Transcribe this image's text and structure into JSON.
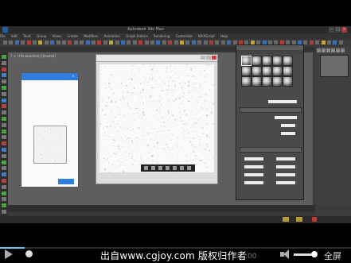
{
  "app": {
    "title": "Autodesk 3ds Max",
    "menus": [
      "File",
      "Edit",
      "Tools",
      "Group",
      "Views",
      "Create",
      "Modifiers",
      "Animation",
      "Graph Editors",
      "Rendering",
      "Customize",
      "MAXScript",
      "Help"
    ],
    "viewport_label": "[ + ] [Perspective] [Shaded]"
  },
  "left_panel": {
    "title": "",
    "close": "×",
    "rows": [
      "",
      "",
      "",
      "",
      ""
    ],
    "highlight_rows": [
      "",
      ""
    ],
    "ok_label": ""
  },
  "viewer": {
    "title": ""
  },
  "material_editor": {
    "title": "",
    "menus": "",
    "rows": [
      "",
      "",
      "",
      "",
      "",
      ""
    ]
  },
  "player": {
    "progress": 0.07,
    "volume": 0.78,
    "watermark": "出自www.cgjoy.com 版权归作者",
    "timecode": ":00",
    "fullscreen_label": "全屏"
  }
}
